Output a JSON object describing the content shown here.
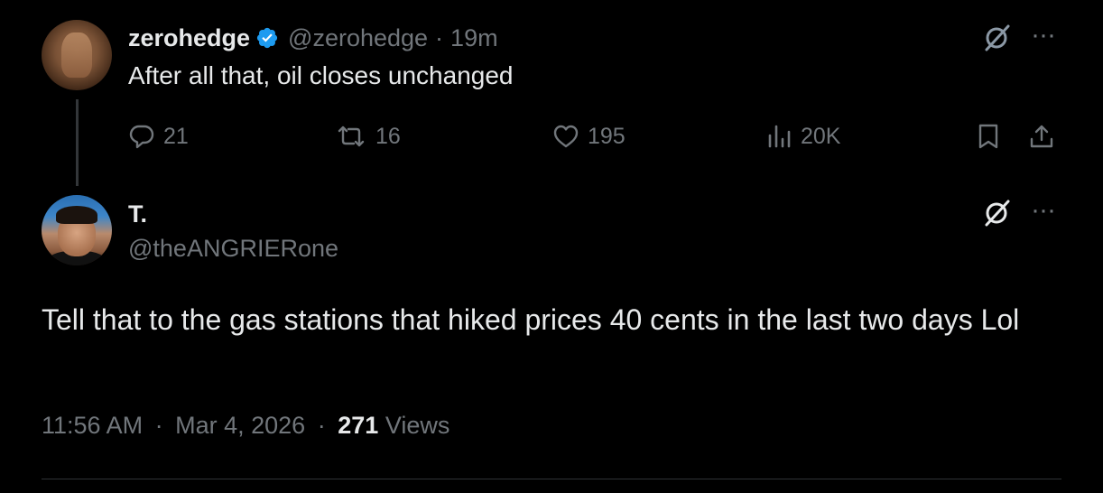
{
  "parent_tweet": {
    "display_name": "zerohedge",
    "handle": "@zerohedge",
    "separator": "·",
    "time": "19m",
    "text": "After all that, oil closes unchanged",
    "actions": {
      "replies": "21",
      "retweets": "16",
      "likes": "195",
      "views": "20K"
    },
    "icons": {
      "verified": "verified-badge-icon",
      "grok": "grok-icon",
      "more": "more-icon",
      "reply": "reply-icon",
      "retweet": "retweet-icon",
      "like": "heart-icon",
      "views": "views-icon",
      "bookmark": "bookmark-icon",
      "share": "share-icon"
    },
    "more_glyph": "···"
  },
  "reply_tweet": {
    "display_name": "T.",
    "handle": "@theANGRIERone",
    "text": "Tell that to the gas stations that hiked prices 40 cents in the last two days Lol",
    "time": "11:56 AM",
    "separator": "·",
    "date": "Mar 4, 2026",
    "views_count": "271",
    "views_label": "Views",
    "more_glyph": "···"
  },
  "colors": {
    "background": "#000000",
    "primary_text": "#e7e9ea",
    "muted_text": "#71767b",
    "verified_blue": "#1d9bf0",
    "divider": "#2f3336"
  }
}
